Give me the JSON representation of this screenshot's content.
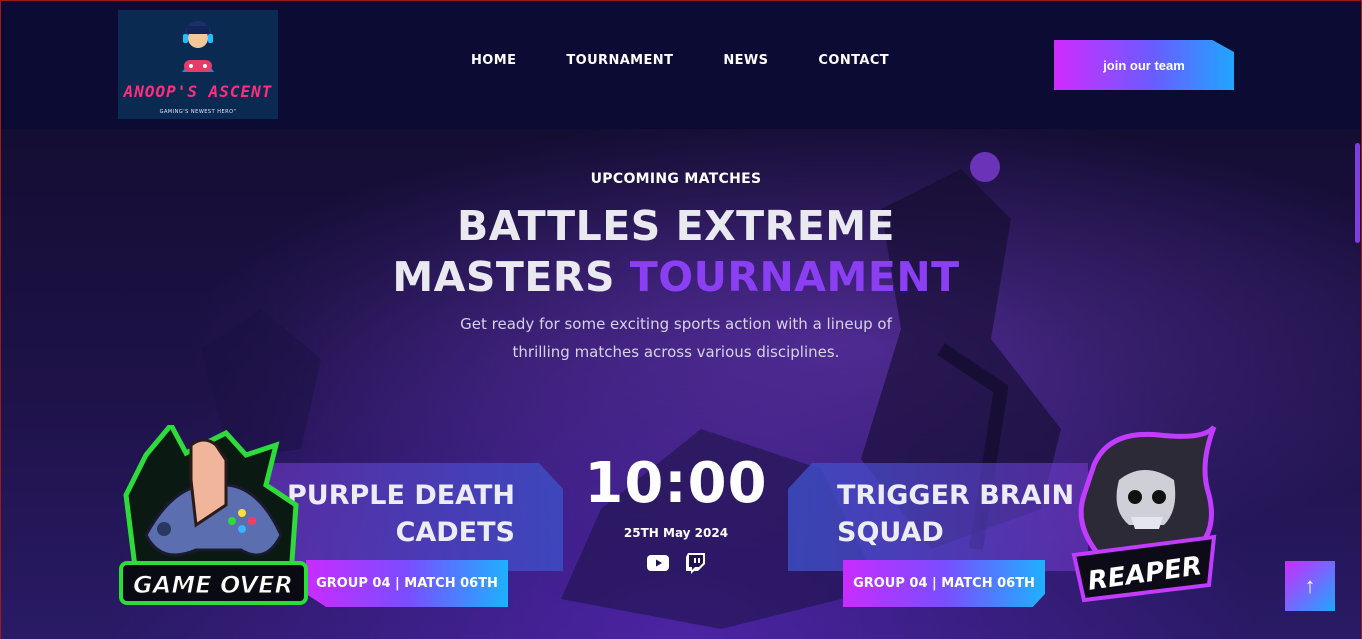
{
  "brand": {
    "name": "ANOOP'S ASCENT",
    "tagline": "GAMING'S NEWEST HERO\""
  },
  "nav": {
    "items": [
      {
        "label": "HOME"
      },
      {
        "label": "TOURNAMENT"
      },
      {
        "label": "NEWS"
      },
      {
        "label": "CONTACT"
      }
    ],
    "cta_label": "join our team"
  },
  "hero": {
    "eyebrow": "UPCOMING MATCHES",
    "headline_line1": "BATTLES EXTREME",
    "headline_line2_plain": "MASTERS ",
    "headline_line2_accent": "TOURNAMENT",
    "description_line1": "Get ready for some exciting sports action with a lineup of",
    "description_line2": "thrilling matches across various disciplines."
  },
  "match": {
    "team_a": {
      "name_line1": "PURPLE DEATH",
      "name_line2": "CADETS",
      "group_label": "GROUP 04 | MATCH 06TH",
      "badge_text": "GAME OVER"
    },
    "team_b": {
      "name_line1": "TRIGGER BRAIN",
      "name_line2": "SQUAD",
      "group_label": "GROUP 04 | MATCH 06TH",
      "badge_text": "REAPER"
    },
    "time": "10:00",
    "date": "25TH May 2024",
    "socials": [
      "youtube-icon",
      "twitch-icon"
    ]
  },
  "colors": {
    "accent_purple": "#8b3ff2",
    "gradient_pink": "#d02bff",
    "gradient_blue": "#1fa6ff",
    "header_bg": "#0c0b33",
    "logo_text": "#ff2e7a"
  }
}
